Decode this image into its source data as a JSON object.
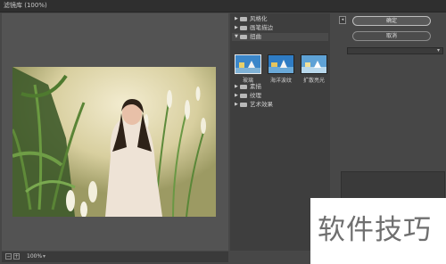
{
  "window": {
    "title": "滤镜库 (100%)"
  },
  "filter_categories": [
    {
      "label": "风格化",
      "expanded": false
    },
    {
      "label": "画笔描边",
      "expanded": false
    },
    {
      "label": "扭曲",
      "expanded": true
    },
    {
      "label": "素描",
      "expanded": false
    },
    {
      "label": "纹理",
      "expanded": false
    },
    {
      "label": "艺术效果",
      "expanded": false
    }
  ],
  "distort_filters": [
    {
      "label": "玻璃",
      "selected": true
    },
    {
      "label": "海洋波纹",
      "selected": false
    },
    {
      "label": "扩散亮光",
      "selected": false
    }
  ],
  "actions": {
    "ok_label": "确定",
    "cancel_label": "取消"
  },
  "status": {
    "zoom": "100%",
    "zoom_out": "−",
    "zoom_in": "+"
  },
  "watermark": {
    "text": "软件技巧"
  }
}
